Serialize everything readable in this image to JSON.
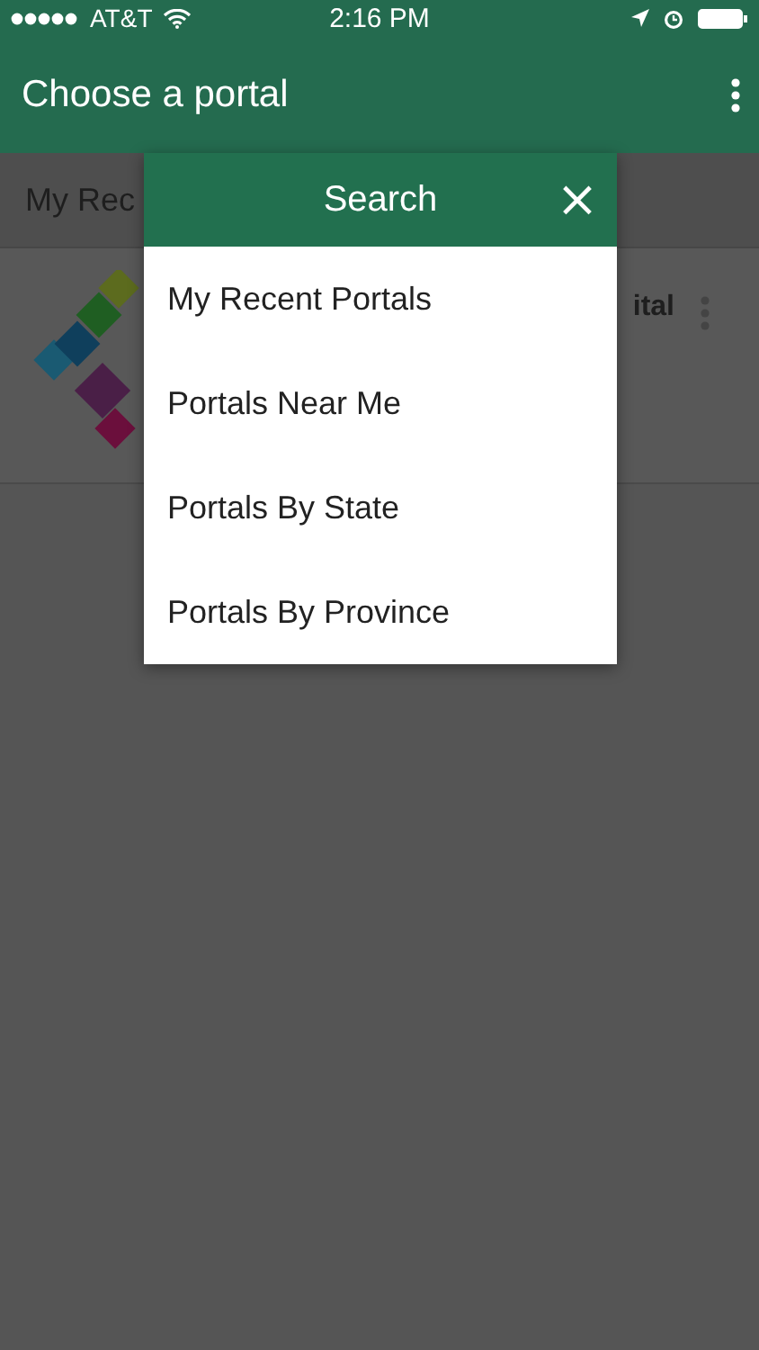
{
  "status_bar": {
    "carrier": "AT&T",
    "time": "2:16 PM"
  },
  "app_bar": {
    "title": "Choose a portal"
  },
  "section_header": {
    "label": "My Rec"
  },
  "portal_card": {
    "title": "ital"
  },
  "dialog": {
    "title": "Search",
    "close": "×",
    "items": [
      {
        "label": "My Recent Portals"
      },
      {
        "label": "Portals Near Me"
      },
      {
        "label": "Portals By State"
      },
      {
        "label": "Portals By Province"
      }
    ]
  }
}
